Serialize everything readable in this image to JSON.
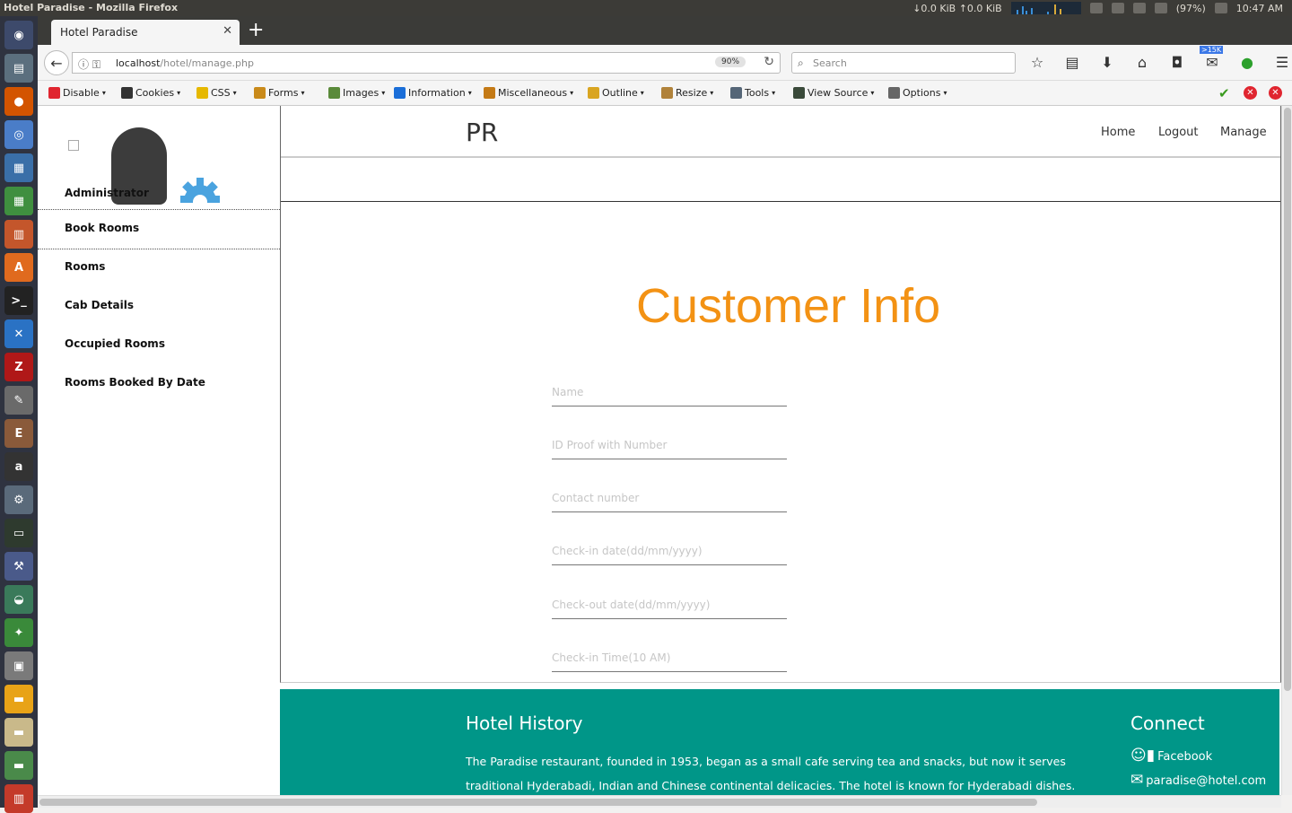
{
  "system_bar": {
    "window_title": "Hotel Paradise - Mozilla Firefox",
    "network": "↓0.0 KiB ↑0.0 KiB",
    "battery": "(97%)",
    "time": "10:47 AM"
  },
  "browser": {
    "tab_title": "Hotel Paradise",
    "url_host": "localhost",
    "url_path": "/hotel/manage.php",
    "zoom": "90%",
    "search_placeholder": "Search",
    "badge_count": ">15K"
  },
  "devtoolbar": [
    {
      "label": "Disable",
      "color": "#e0252f"
    },
    {
      "label": "Cookies",
      "color": "#333333"
    },
    {
      "label": "CSS",
      "color": "#e6b800"
    },
    {
      "label": "Forms",
      "color": "#c98a1a"
    },
    {
      "label": "Images",
      "color": "#5a8a3a"
    },
    {
      "label": "Information",
      "color": "#1a6ed8"
    },
    {
      "label": "Miscellaneous",
      "color": "#c47a16"
    },
    {
      "label": "Outline",
      "color": "#d9a521"
    },
    {
      "label": "Resize",
      "color": "#b0823a"
    },
    {
      "label": "Tools",
      "color": "#556677"
    },
    {
      "label": "View Source",
      "color": "#3a4a3a"
    },
    {
      "label": "Options",
      "color": "#666666"
    }
  ],
  "sidebar": {
    "admin_label": "Administrator",
    "items": [
      {
        "label": "Book Rooms"
      },
      {
        "label": "Rooms"
      },
      {
        "label": "Cab Details"
      },
      {
        "label": "Occupied Rooms"
      },
      {
        "label": "Rooms Booked By Date"
      }
    ]
  },
  "header": {
    "brand": "PR",
    "nav": [
      {
        "label": "Home"
      },
      {
        "label": "Logout"
      },
      {
        "label": "Manage"
      }
    ]
  },
  "form": {
    "title": "Customer Info",
    "fields": [
      {
        "placeholder": "Name",
        "value": ""
      },
      {
        "placeholder": "ID Proof with Number",
        "value": ""
      },
      {
        "placeholder": "Contact number",
        "value": ""
      },
      {
        "placeholder": "Check-in date(dd/mm/yyyy)",
        "value": ""
      },
      {
        "placeholder": "Check-out date(dd/mm/yyyy)",
        "value": ""
      },
      {
        "placeholder": "Check-in Time(10 AM)",
        "value": ""
      }
    ]
  },
  "footer": {
    "history_title": "Hotel History",
    "history_text": "The Paradise restaurant, founded in 1953, began as a small cafe serving tea and snacks, but now it serves traditional Hyderabadi, Indian and Chinese continental delicacies. The hotel is known for Hyderabadi dishes.",
    "connect_title": "Connect",
    "facebook": "Facebook",
    "email": "paradise@hotel.com",
    "accent": "#009688"
  },
  "colors": {
    "heading": "#f39214",
    "footer": "#009688"
  }
}
